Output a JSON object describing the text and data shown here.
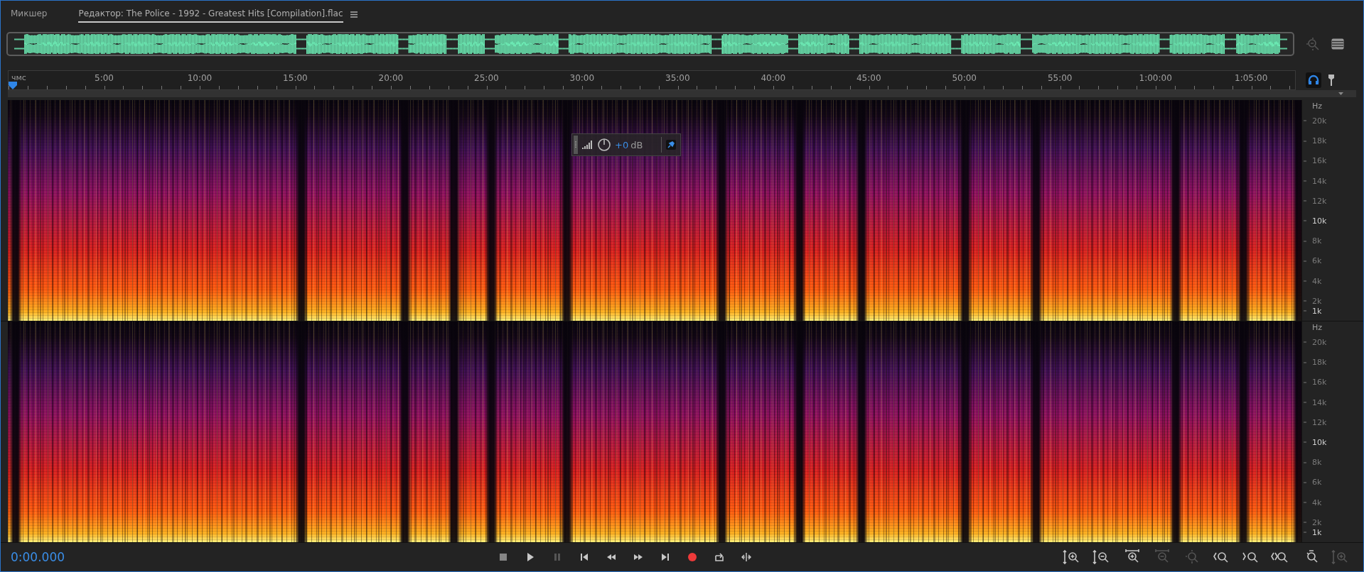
{
  "tabs": [
    {
      "label": "Микшер",
      "selected": false
    },
    {
      "label": "Редактор: The Police - 1992 - Greatest Hits [Compilation].flac",
      "selected": true
    }
  ],
  "ruler": {
    "unit": "чмс",
    "ticks": [
      "5:00",
      "10:00",
      "15:00",
      "20:00",
      "25:00",
      "30:00",
      "35:00",
      "40:00",
      "45:00",
      "50:00",
      "55:00",
      "1:00:00",
      "1:05:00"
    ]
  },
  "hud": {
    "gain_value": "+0",
    "gain_unit": "dB"
  },
  "channels": [
    {
      "unit": "Hz",
      "labels": [
        {
          "text": "20k",
          "major": false
        },
        {
          "text": "18k",
          "major": false
        },
        {
          "text": "16k",
          "major": false
        },
        {
          "text": "14k",
          "major": false
        },
        {
          "text": "12k",
          "major": false
        },
        {
          "text": "10k",
          "major": true
        },
        {
          "text": "8k",
          "major": false
        },
        {
          "text": "6k",
          "major": false
        },
        {
          "text": "4k",
          "major": false
        },
        {
          "text": "2k",
          "major": false
        },
        {
          "text": "1k",
          "major": true
        }
      ]
    },
    {
      "unit": "Hz",
      "labels": [
        {
          "text": "20k",
          "major": false
        },
        {
          "text": "18k",
          "major": false
        },
        {
          "text": "16k",
          "major": false
        },
        {
          "text": "14k",
          "major": false
        },
        {
          "text": "12k",
          "major": false
        },
        {
          "text": "10k",
          "major": true
        },
        {
          "text": "8k",
          "major": false
        },
        {
          "text": "6k",
          "major": false
        },
        {
          "text": "4k",
          "major": false
        },
        {
          "text": "2k",
          "major": false
        },
        {
          "text": "1k",
          "major": true
        }
      ]
    }
  ],
  "time": "0:00.000",
  "transport": [
    {
      "kind": "stop",
      "disabled": false
    },
    {
      "kind": "play",
      "disabled": false
    },
    {
      "kind": "pause",
      "disabled": true
    },
    {
      "kind": "to-start",
      "disabled": false
    },
    {
      "kind": "rewind",
      "disabled": false
    },
    {
      "kind": "fast-forward",
      "disabled": false
    },
    {
      "kind": "to-end",
      "disabled": false
    },
    {
      "kind": "record",
      "disabled": false
    },
    {
      "kind": "loop",
      "disabled": false
    },
    {
      "kind": "skip",
      "disabled": false
    }
  ],
  "zoom_tools": [
    {
      "kind": "zoom-in-amplitude",
      "disabled": false
    },
    {
      "kind": "zoom-out-amplitude",
      "disabled": false
    },
    {
      "kind": "zoom-in-time",
      "disabled": false
    },
    {
      "kind": "zoom-out-time",
      "disabled": true
    },
    {
      "kind": "zoom-full",
      "disabled": true
    },
    {
      "kind": "zoom-in-start",
      "disabled": false
    },
    {
      "kind": "zoom-in-end",
      "disabled": false
    },
    {
      "kind": "zoom-selection",
      "disabled": false
    },
    {
      "kind": "zoom-playhead",
      "disabled": false
    },
    {
      "kind": "zoom-in-frequency",
      "disabled": true
    }
  ]
}
